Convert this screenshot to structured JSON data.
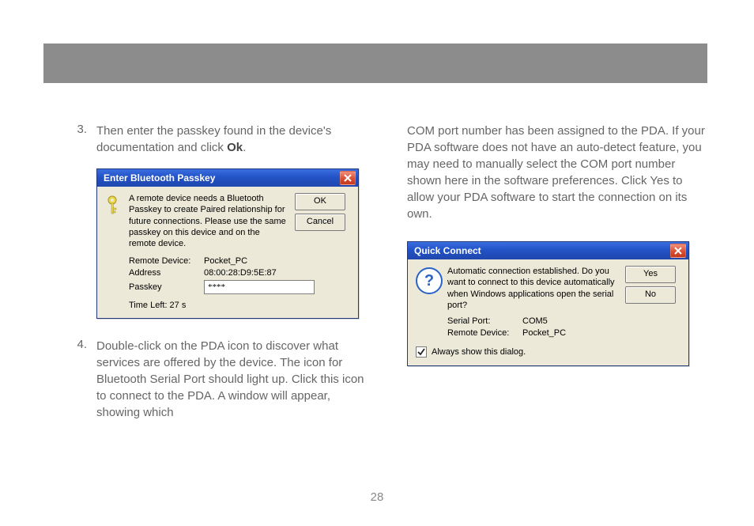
{
  "page_number": "28",
  "left": {
    "step3": {
      "num": "3.",
      "text_a": "Then enter the passkey found in the device's documentation and click ",
      "text_ok": "Ok",
      "text_b": "."
    },
    "dialog1": {
      "title": "Enter Bluetooth Passkey",
      "message": "A remote device needs a Bluetooth Passkey to create Paired relationship for future connections. Please use the same passkey on this device and on the remote device.",
      "remote_device_label": "Remote Device:",
      "remote_device_value": "Pocket_PC",
      "address_label": "Address",
      "address_value": "08:00:28:D9:5E:87",
      "passkey_label": "Passkey",
      "passkey_value": "****",
      "time_left": "Time Left: 27 s",
      "ok_btn": "OK",
      "cancel_btn": "Cancel"
    },
    "step4": {
      "num": "4.",
      "text": "Double-click on the PDA icon to discover what services are offered by the device. The icon for Bluetooth Serial Port should light up. Click this icon to connect to the PDA. A window will appear, showing which"
    }
  },
  "right": {
    "cont_text": "COM port number has been assigned to the PDA. If your PDA software does not have an auto-detect feature, you may need to manually select the COM port number shown here in the software preferences. Click Yes to allow your PDA software to start the connection on its own.",
    "dialog2": {
      "title": "Quick Connect",
      "message": "Automatic connection established. Do you want to connect to this device automatically when Windows applications open the serial port?",
      "serial_port_label": "Serial Port:",
      "serial_port_value": "COM5",
      "remote_device_label": "Remote Device:",
      "remote_device_value": "Pocket_PC",
      "checkbox_label": "Always show this dialog.",
      "yes_btn": "Yes",
      "no_btn": "No"
    }
  }
}
